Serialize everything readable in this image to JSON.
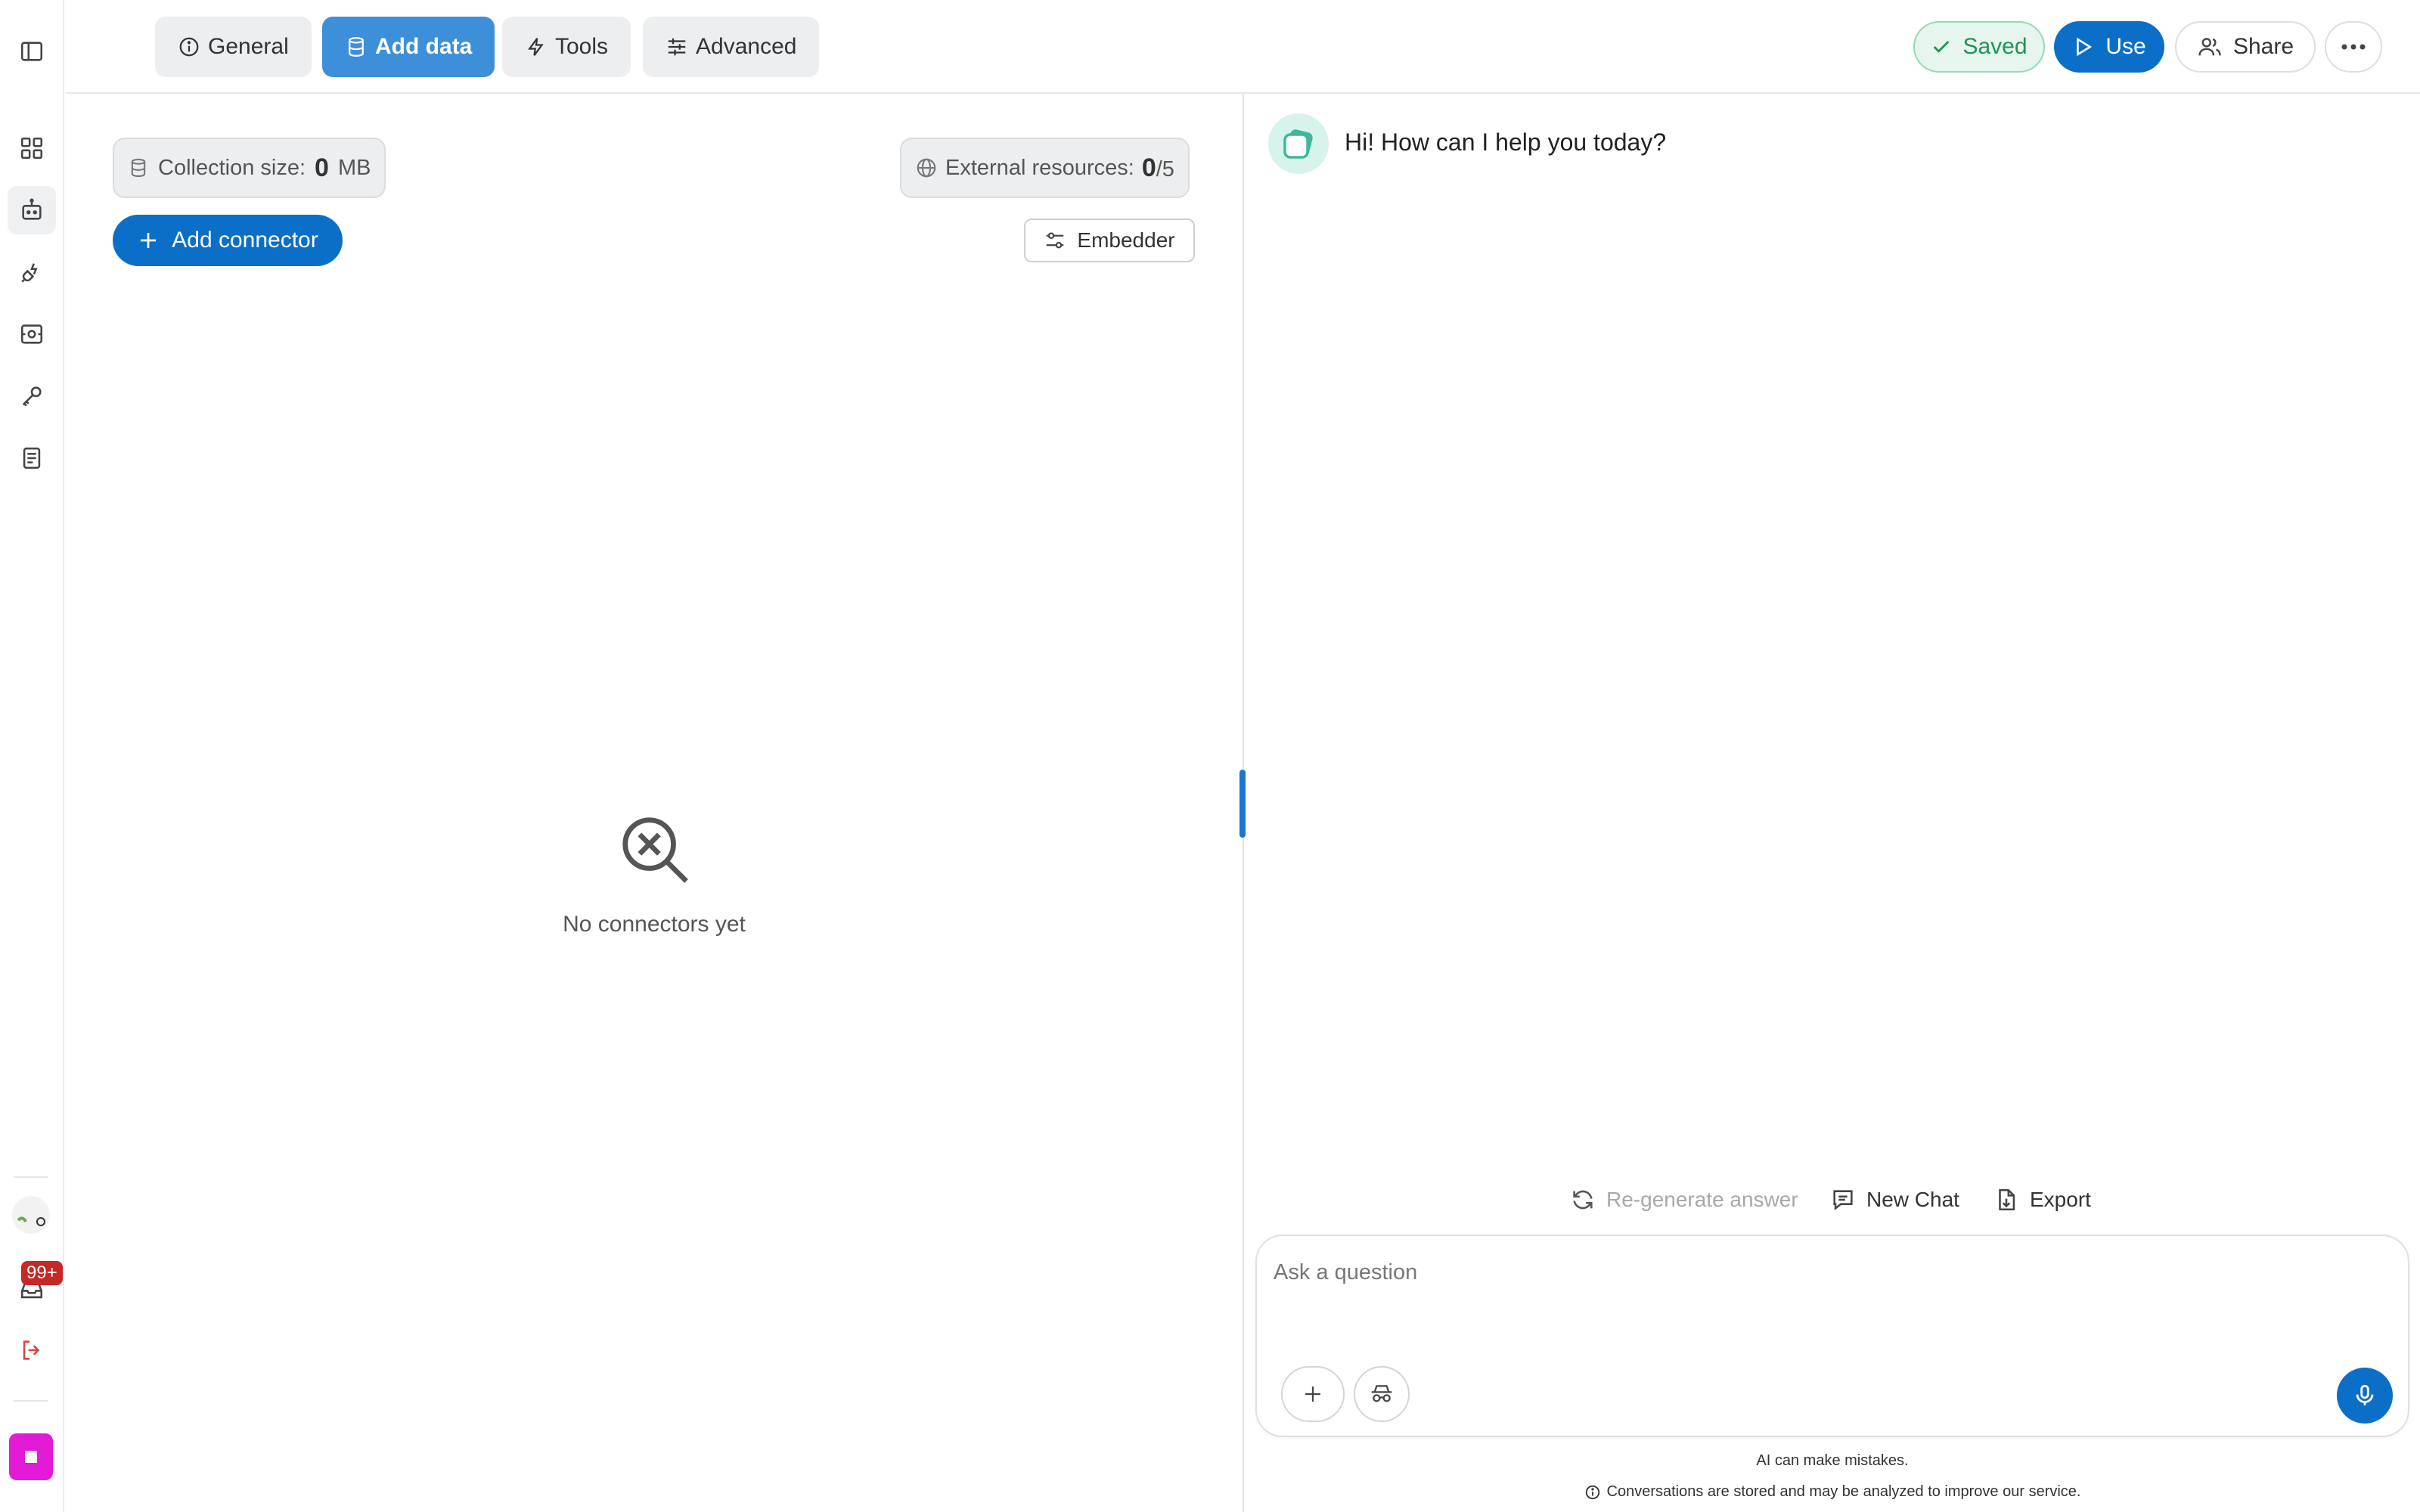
{
  "toolbar": {
    "tabs": [
      {
        "label": "General",
        "icon": "info-icon"
      },
      {
        "label": "Add data",
        "icon": "database-icon",
        "active": true
      },
      {
        "label": "Tools",
        "icon": "lightning-icon"
      },
      {
        "label": "Advanced",
        "icon": "sliders-icon"
      }
    ],
    "saved_label": "Saved",
    "use_label": "Use",
    "share_label": "Share"
  },
  "sidebar": {
    "notification_badge": "99+",
    "items": [
      "sidebar-toggle-icon",
      "dashboard-icon",
      "bot-icon",
      "plug-icon",
      "scan-icon",
      "key-icon",
      "document-icon"
    ]
  },
  "data_panel": {
    "collection_size_label": "Collection size:",
    "collection_size_value": "0",
    "collection_size_unit": "MB",
    "external_resources_label": "External resources:",
    "external_resources_value": "0",
    "external_resources_max": "/5",
    "add_connector_label": "Add connector",
    "embedder_label": "Embedder",
    "empty_state_text": "No connectors yet"
  },
  "chat": {
    "greeting": "Hi! How can I help you today?",
    "regenerate_label": "Re-generate answer",
    "new_chat_label": "New Chat",
    "export_label": "Export",
    "input_placeholder": "Ask a question",
    "disclaimer": "AI can make mistakes.",
    "privacy_notice": "Conversations are stored and may be analyzed to improve our service."
  },
  "colors": {
    "primary": "#0b6fc7",
    "active_tab": "#3d8fd9",
    "saved_green": "#1e9455",
    "badge_red": "#c62828",
    "app_magenta": "#e31bd7"
  }
}
